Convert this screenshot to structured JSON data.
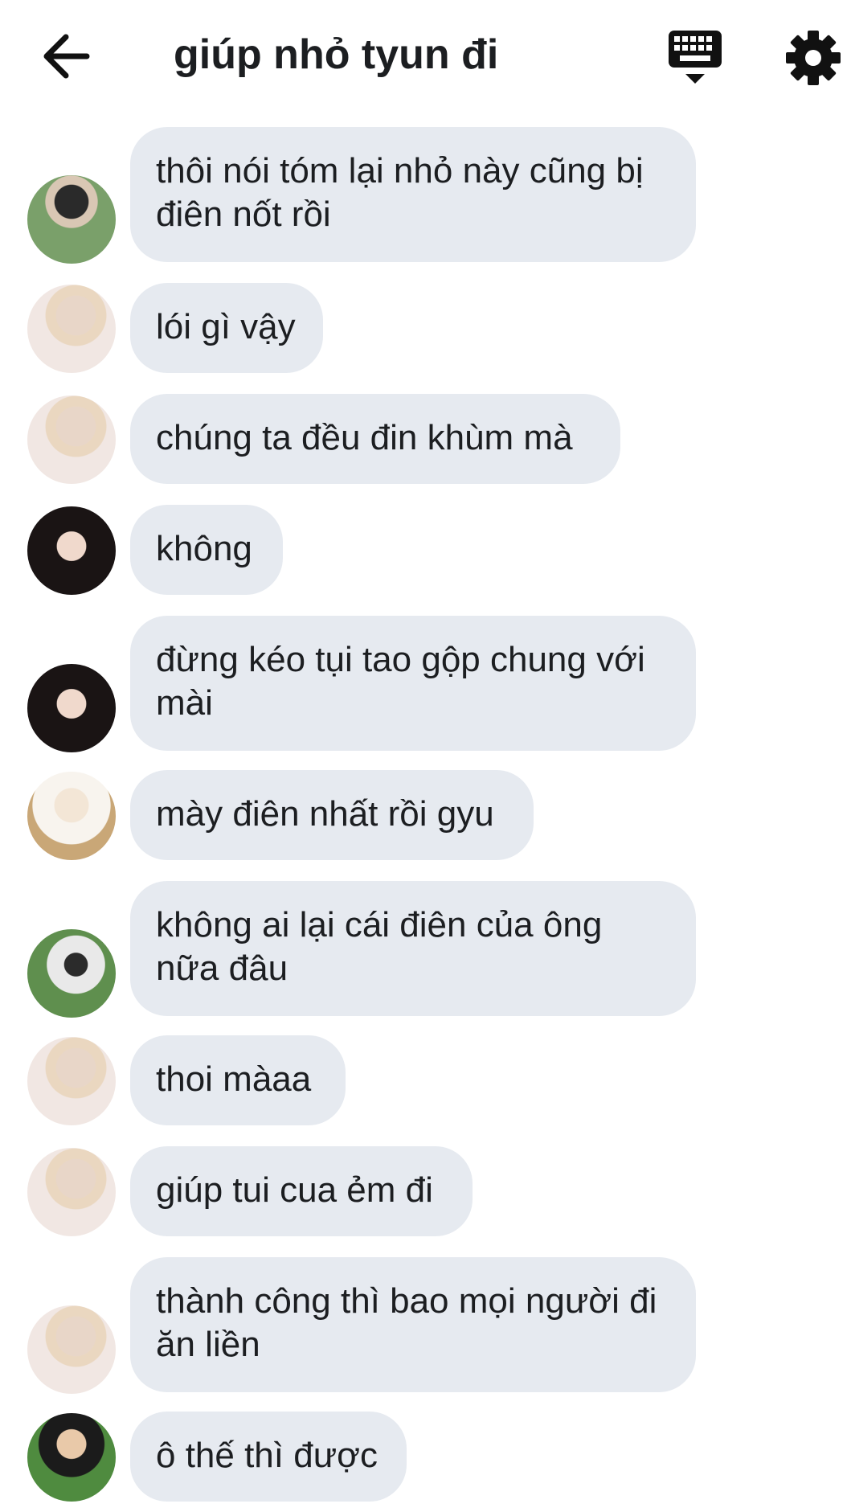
{
  "header": {
    "title": "giúp nhỏ tyun đi",
    "back_icon": "arrow-left-icon",
    "keyboard_icon": "keyboard-hide-icon",
    "settings_icon": "gear-icon"
  },
  "colors": {
    "bubble_bg": "#e6eaf0",
    "text": "#1c1e21",
    "background": "#ffffff"
  },
  "messages": [
    {
      "text": "thôi nói tóm lại nhỏ này cũng bị điên nốt rồi",
      "avatar": "avatar-dark-hair-boy"
    },
    {
      "text": "lói gì vậy",
      "avatar": "avatar-blonde-boy"
    },
    {
      "text": "chúng ta đều đin khùm mà",
      "avatar": "avatar-blonde-boy"
    },
    {
      "text": "không",
      "avatar": "avatar-long-hair-girl"
    },
    {
      "text": "đừng kéo tụi tao gộp chung với mài",
      "avatar": "avatar-long-hair-girl"
    },
    {
      "text": "mày điên nhất rồi gyu",
      "avatar": "avatar-white-sweater-boy"
    },
    {
      "text": "không ai lại cái điên của ông nữa đâu",
      "avatar": "avatar-outdoor-boy"
    },
    {
      "text": "thoi màaa",
      "avatar": "avatar-blonde-boy"
    },
    {
      "text": "giúp tui cua ẻm đi",
      "avatar": "avatar-blonde-boy"
    },
    {
      "text": "thành công thì bao mọi người đi ăn liền",
      "avatar": "avatar-blonde-boy"
    },
    {
      "text": "ô thế thì được",
      "avatar": "avatar-sunglasses-girl"
    }
  ]
}
